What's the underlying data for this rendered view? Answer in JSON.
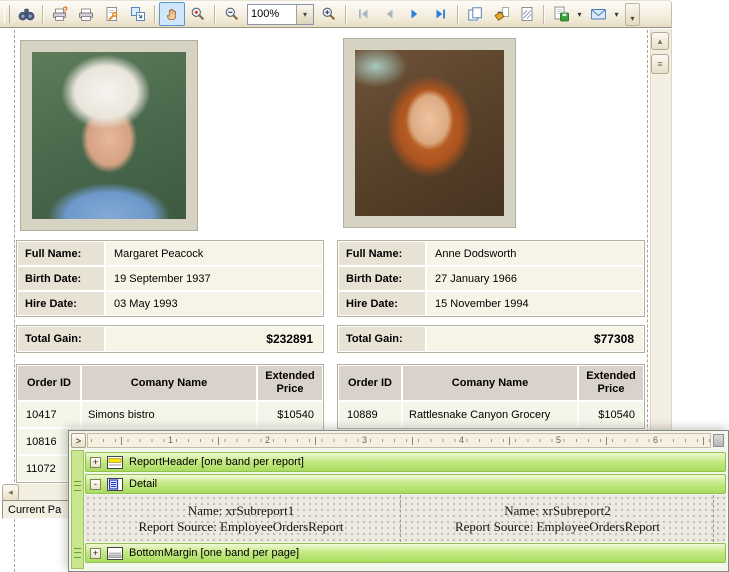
{
  "toolbar": {
    "zoom_value": "100%",
    "dropdown_glyph": "▾",
    "overflow_glyph": "▾"
  },
  "colors": {
    "accent_blue": "#2a7fd8",
    "band_green": "#b7e47c",
    "selected_tool_bg": "#cfe6fb"
  },
  "preview": {
    "status_text": "Current Pa",
    "scroll_left_glyph": "◂",
    "scroll_up_glyph": "▴",
    "scroll_thumb_glyph": "≡",
    "employees": [
      {
        "info_rows": [
          {
            "label": "Full Name:",
            "value": "Margaret Peacock"
          },
          {
            "label": "Birth Date:",
            "value": "19 September 1937"
          },
          {
            "label": "Hire Date:",
            "value": "03 May 1993"
          }
        ],
        "total": {
          "label": "Total Gain:",
          "value": "$232891"
        },
        "orders": {
          "headers": [
            "Order ID",
            "Comany Name",
            "Extended Price"
          ],
          "rows": [
            {
              "order_id": "10417",
              "company": "Simons bistro",
              "price": "$10540"
            },
            {
              "order_id": "10816",
              "company": "",
              "price": ""
            },
            {
              "order_id": "11072",
              "company": "",
              "price": ""
            }
          ]
        }
      },
      {
        "info_rows": [
          {
            "label": "Full Name:",
            "value": "Anne Dodsworth"
          },
          {
            "label": "Birth Date:",
            "value": "27 January 1966"
          },
          {
            "label": "Hire Date:",
            "value": "15 November 1994"
          }
        ],
        "total": {
          "label": "Total Gain:",
          "value": "$77308"
        },
        "orders": {
          "headers": [
            "Order ID",
            "Comany Name",
            "Extended Price"
          ],
          "rows": [
            {
              "order_id": "10889",
              "company": "Rattlesnake Canyon Grocery",
              "price": "$10540"
            }
          ]
        }
      }
    ]
  },
  "designer": {
    "collapse_glyph": ">",
    "ruler_marks": [
      "1",
      "2",
      "3",
      "4",
      "5",
      "6"
    ],
    "bands": {
      "report_header": {
        "expander": "+",
        "label": "ReportHeader [one band per report]"
      },
      "detail": {
        "expander": "-",
        "label": "Detail"
      },
      "bottom_margin": {
        "expander": "+",
        "label": "BottomMargin [one band per page]"
      }
    },
    "subreports": [
      {
        "name": "Name: xrSubreport1",
        "source": "Report Source: EmployeeOrdersReport"
      },
      {
        "name": "Name: xrSubreport2",
        "source": "Report Source: EmployeeOrdersReport"
      }
    ]
  }
}
